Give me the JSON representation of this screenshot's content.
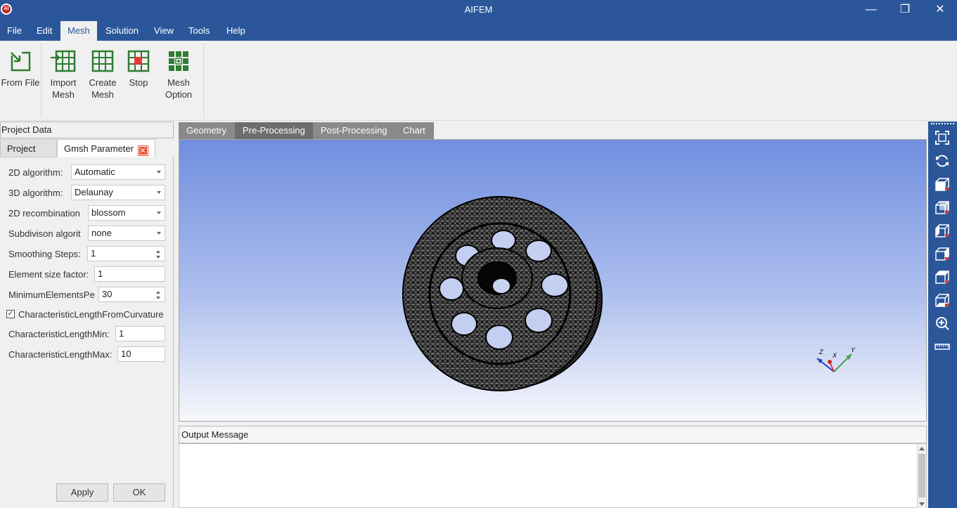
{
  "window": {
    "title": "AIFEM",
    "icon": "aifem-logo-icon",
    "icon_text": "AI",
    "controls": {
      "minimize": "—",
      "maximize": "❐",
      "close": "✕"
    }
  },
  "menu": {
    "items": [
      "File",
      "Edit",
      "Mesh",
      "Solution",
      "View",
      "Tools",
      "Help"
    ],
    "active": "Mesh"
  },
  "ribbon": {
    "buttons": [
      {
        "label": "From File",
        "icon": "from-file-icon"
      },
      {
        "label": "Import Mesh",
        "icon": "import-mesh-icon"
      },
      {
        "label": "Create Mesh",
        "icon": "create-mesh-icon"
      },
      {
        "label": "Stop",
        "icon": "stop-icon"
      },
      {
        "label": "Mesh Option",
        "icon": "mesh-option-icon"
      }
    ],
    "icon_color": "#2e7d32",
    "stop_color": "#e53935"
  },
  "left_panel": {
    "header": "Project Data",
    "tabs": [
      "Project",
      "Gmsh Parameter"
    ],
    "active_tab": "Gmsh Parameter",
    "tab_close": "✕",
    "params": {
      "alg2d": {
        "label": "2D algorithm:",
        "value": "Automatic"
      },
      "alg3d": {
        "label": "3D algorithm:",
        "value": "Delaunay"
      },
      "recomb2d": {
        "label": "2D recombination",
        "value": "blossom"
      },
      "subdiv": {
        "label": "Subdivison algorit",
        "value": "none"
      },
      "smoothing": {
        "label": "Smoothing Steps:",
        "value": "1"
      },
      "size_factor": {
        "label": "Element size factor:",
        "value": "1"
      },
      "min_elems": {
        "label": "MinimumElementsPe",
        "value": "30"
      },
      "curvature": {
        "label": "CharacteristicLengthFromCurvature",
        "checked": true,
        "mark": "✓"
      },
      "len_min": {
        "label": "CharacteristicLengthMin:",
        "value": "1"
      },
      "len_max": {
        "label": "CharacteristicLengthMax:",
        "value": "10"
      }
    },
    "buttons": {
      "apply": "Apply",
      "ok": "OK"
    }
  },
  "center": {
    "tabs": [
      "Geometry",
      "Pre-Processing",
      "Post-Processing",
      "Chart"
    ],
    "active_tab": "Pre-Processing",
    "viewport": {
      "content": "mesh-model",
      "axes_labels": {
        "x": "X",
        "y": "Y",
        "z": "Z"
      },
      "axis_colors": {
        "x": "#e53935",
        "y": "#43a047",
        "z": "#1e3fbf"
      }
    }
  },
  "output": {
    "header": "Output Message",
    "text": ""
  },
  "right_toolbar": {
    "icons": [
      "fit-view-icon",
      "rotate-icon",
      "view-front-icon",
      "view-back-icon",
      "view-left-icon",
      "view-right-icon",
      "view-top-icon",
      "view-bottom-icon",
      "zoom-icon",
      "ruler-icon"
    ]
  }
}
